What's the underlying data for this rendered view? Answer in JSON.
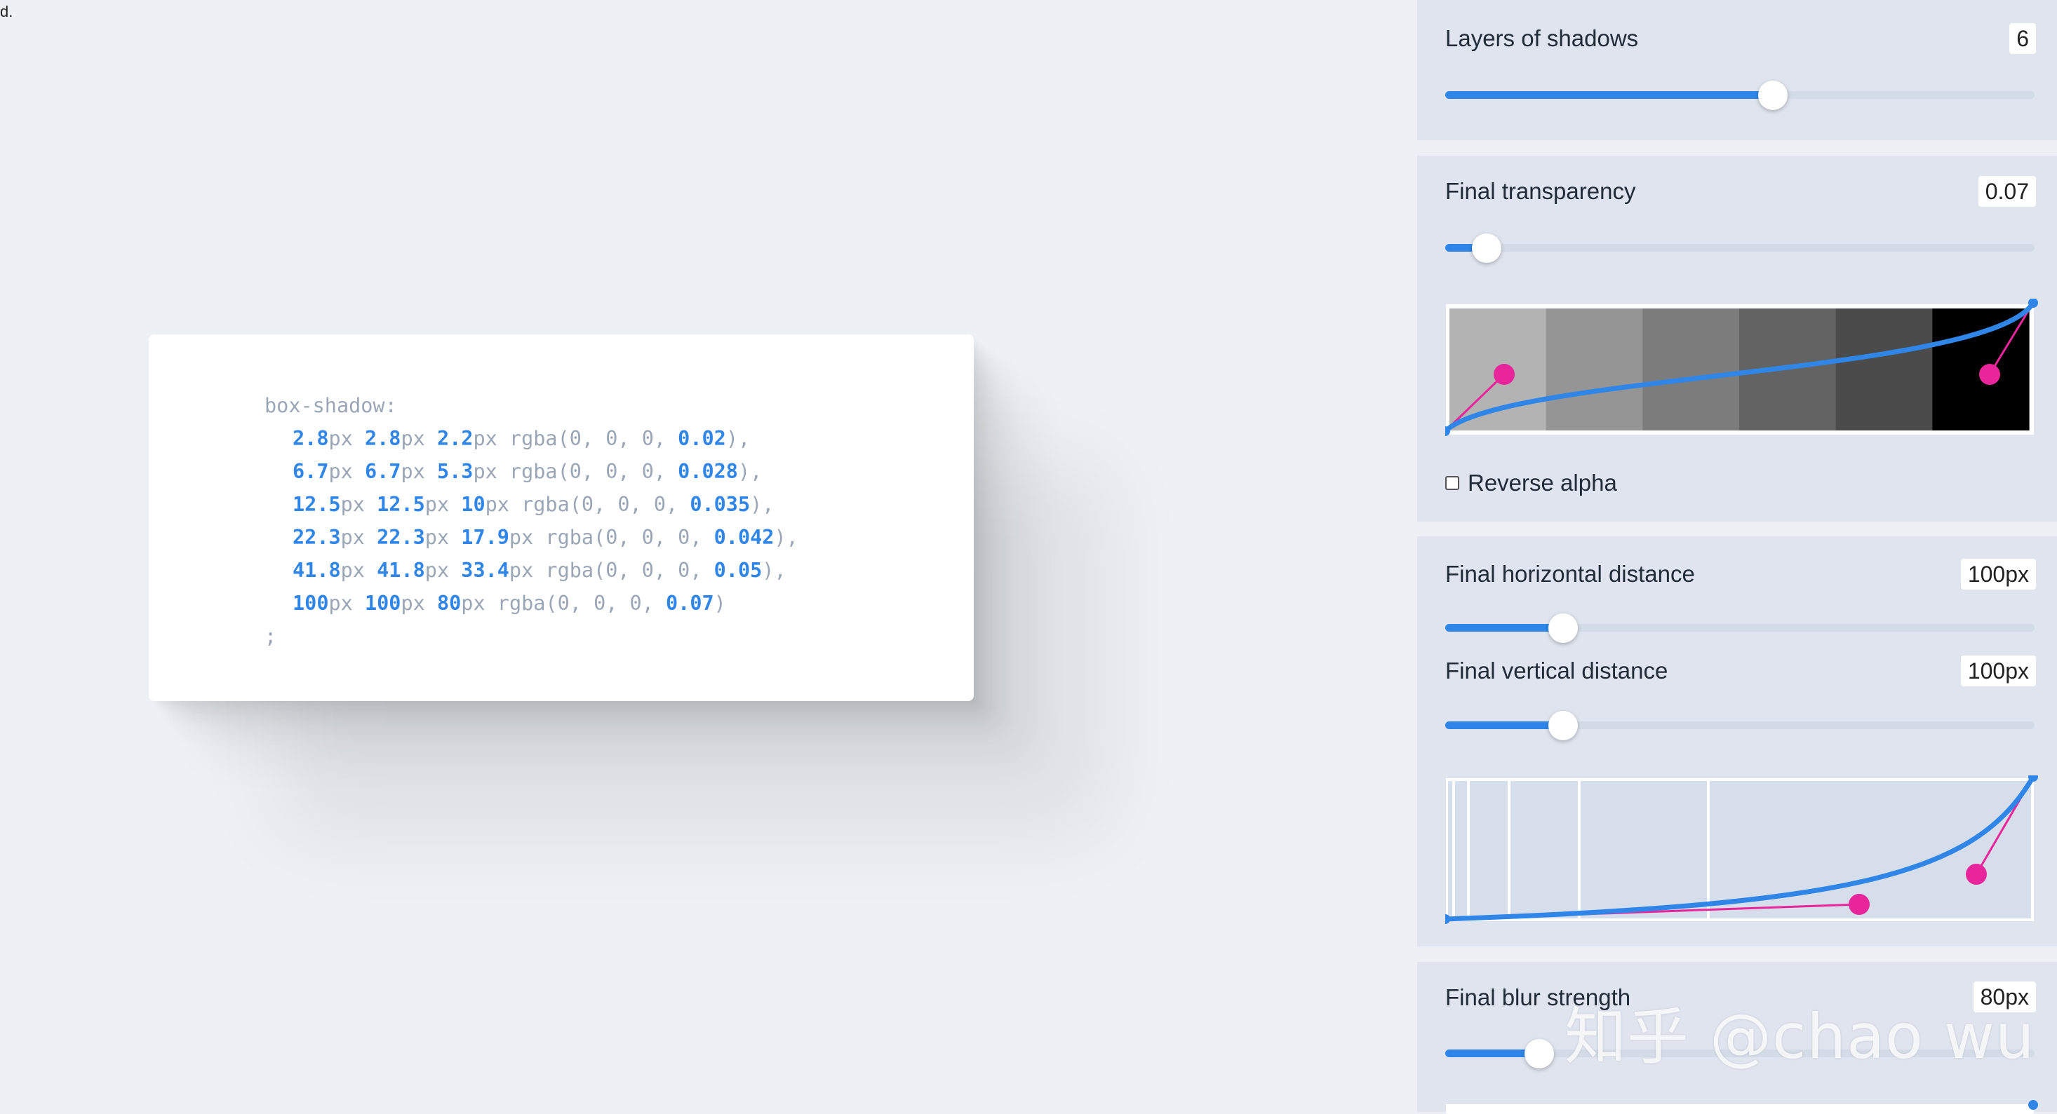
{
  "corner_text": "d.",
  "preview": {
    "property": "box-shadow:",
    "unit": "px",
    "rgba_prefix": "rgba(0, 0, 0, ",
    "terminator": ";",
    "layers": [
      {
        "x": "2.8",
        "y": "2.8",
        "blur": "2.2",
        "alpha": "0.02"
      },
      {
        "x": "6.7",
        "y": "6.7",
        "blur": "5.3",
        "alpha": "0.028"
      },
      {
        "x": "12.5",
        "y": "12.5",
        "blur": "10",
        "alpha": "0.035"
      },
      {
        "x": "22.3",
        "y": "22.3",
        "blur": "17.9",
        "alpha": "0.042"
      },
      {
        "x": "41.8",
        "y": "41.8",
        "blur": "33.4",
        "alpha": "0.05"
      },
      {
        "x": "100",
        "y": "100",
        "blur": "80",
        "alpha": "0.07"
      }
    ]
  },
  "controls": {
    "layers": {
      "label": "Layers of shadows",
      "value": "6",
      "fraction": 0.556
    },
    "transparency": {
      "label": "Final transparency",
      "value": "0.07",
      "fraction": 0.07
    },
    "reverse_alpha": {
      "label": "Reverse alpha",
      "checked": false
    },
    "horizontal": {
      "label": "Final horizontal distance",
      "value": "100px",
      "fraction": 0.2
    },
    "vertical": {
      "label": "Final vertical distance",
      "value": "100px",
      "fraction": 0.2
    },
    "blur": {
      "label": "Final blur strength",
      "value": "80px",
      "fraction": 0.16
    }
  },
  "alpha_swatches": [
    "#b3b3b3",
    "#959595",
    "#7c7c7c",
    "#636363",
    "#4b4b4b",
    "#000000"
  ],
  "colors": {
    "accent": "#2f86e8",
    "handle": "#e8259a",
    "panel": "#dfe4ee"
  },
  "watermark": "知乎 @chao wu"
}
